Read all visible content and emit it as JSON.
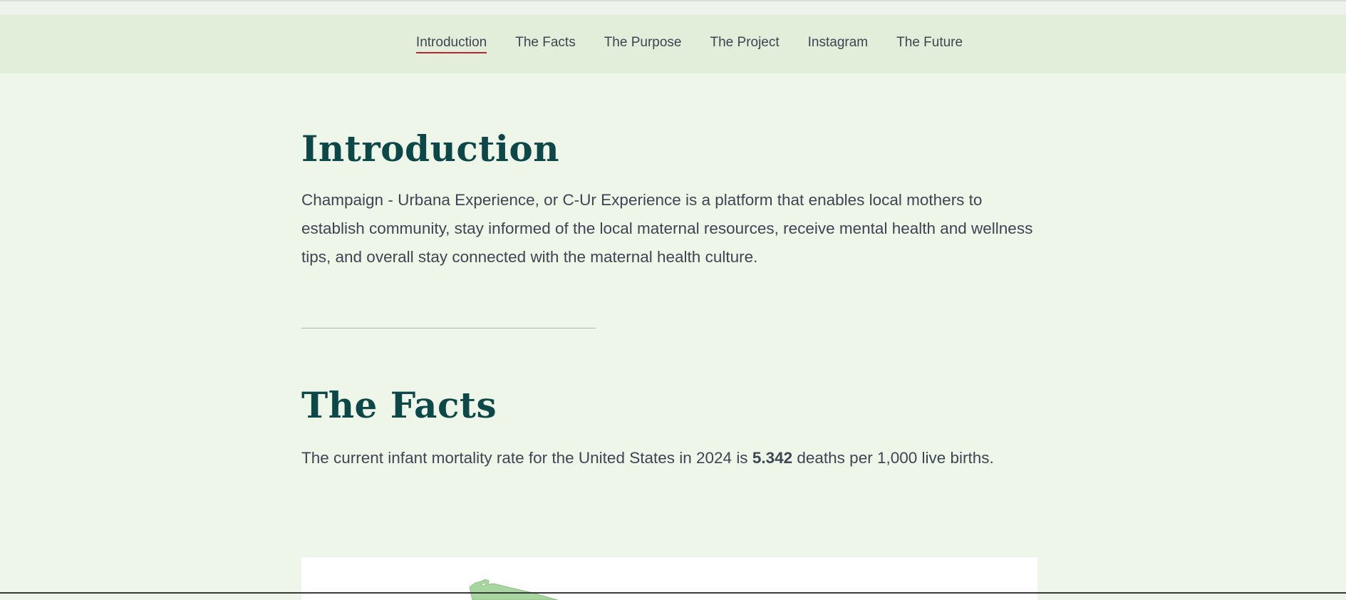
{
  "nav": {
    "items": [
      {
        "label": "Introduction",
        "active": true
      },
      {
        "label": "The Facts",
        "active": false
      },
      {
        "label": "The Purpose",
        "active": false
      },
      {
        "label": "The Project",
        "active": false
      },
      {
        "label": "Instagram",
        "active": false
      },
      {
        "label": "The Future",
        "active": false
      }
    ]
  },
  "intro": {
    "heading": "Introduction",
    "body": "Champaign - Urbana Experience, or C-Ur Experience is a platform that enables local mothers to establish community, stay informed of the local maternal resources, receive mental health and wellness tips, and overall stay connected with the maternal health culture."
  },
  "facts": {
    "heading": "The Facts",
    "body_before": "The current infant mortality rate for the United States in 2024 is ",
    "body_bold": "5.342",
    "body_after": " deaths per 1,000 live births."
  },
  "colors": {
    "background": "#eef6e9",
    "nav_background": "#e2eeda",
    "heading": "#0e4748",
    "text": "#3e4552",
    "active_underline": "#b8282e",
    "map_fill": "#a9d6a0"
  }
}
